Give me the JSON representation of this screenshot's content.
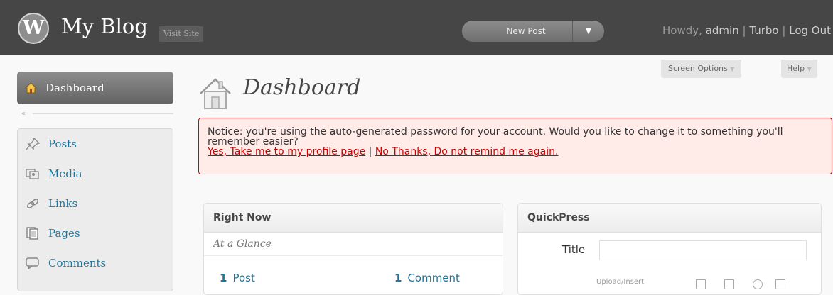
{
  "topbar": {
    "logo_glyph": "W",
    "site_title": "My Blog",
    "visit_site": "Visit Site",
    "new_post": "New Post",
    "new_post_arrow": "▼",
    "howdy_prefix": "Howdy,",
    "user": "admin",
    "separator": "|",
    "turbo": "Turbo",
    "logout": "Log Out"
  },
  "tabs": {
    "screen_options": "Screen Options",
    "help": "Help",
    "arrow": "▼"
  },
  "sidebar": {
    "dashboard": "Dashboard",
    "collapse_icon": "«",
    "items": [
      {
        "label": "Posts",
        "icon": "pushpin-icon"
      },
      {
        "label": "Media",
        "icon": "media-icon"
      },
      {
        "label": "Links",
        "icon": "links-icon"
      },
      {
        "label": "Pages",
        "icon": "pages-icon"
      },
      {
        "label": "Comments",
        "icon": "comments-icon"
      }
    ]
  },
  "main": {
    "title": "Dashboard",
    "notice": {
      "text": "Notice: you're using the auto-generated password for your account. Would you like to change it to something you'll remember easier?",
      "link_yes": "Yes, Take me to my profile page",
      "link_sep": "|",
      "link_no": "No Thanks, Do not remind me again."
    },
    "right_now": {
      "title": "Right Now",
      "subtitle": "At a Glance",
      "posts_count": "1",
      "posts_label": "Post",
      "comments_count": "1",
      "comments_label": "Comment"
    },
    "quickpress": {
      "title": "QuickPress",
      "title_label": "Title",
      "upload_insert": "Upload/Insert"
    }
  },
  "colors": {
    "topbar": "#464646",
    "link": "#21759b",
    "notice_bg": "#ffebe8",
    "notice_border": "#cc0000"
  }
}
